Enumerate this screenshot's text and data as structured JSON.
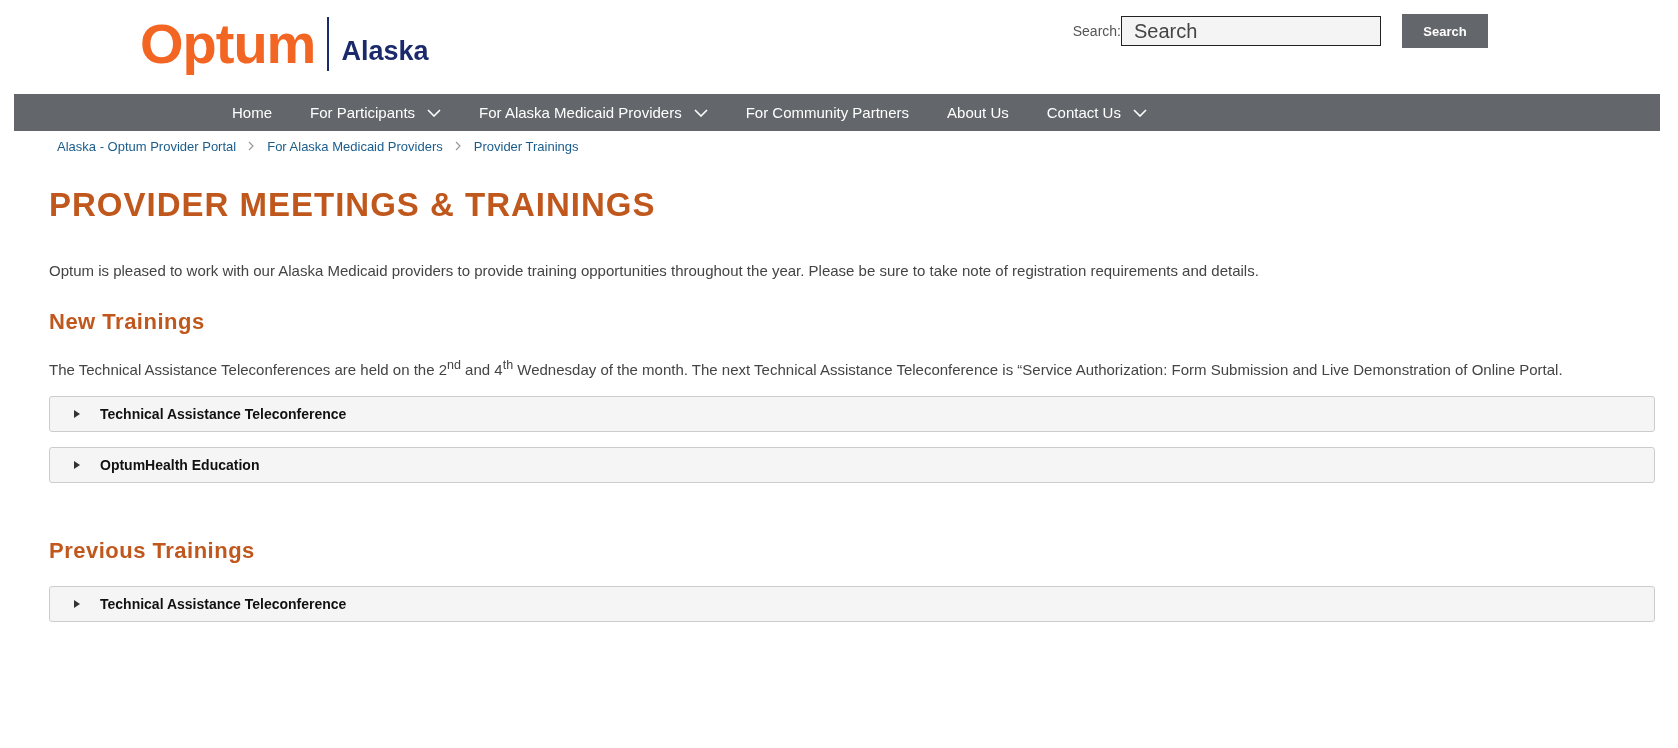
{
  "logo": {
    "brand": "Optum",
    "region": "Alaska"
  },
  "search": {
    "label": "Search:",
    "placeholder": "Search",
    "button": "Search"
  },
  "nav": [
    {
      "label": "Home",
      "dropdown": false
    },
    {
      "label": "For Participants",
      "dropdown": true
    },
    {
      "label": "For Alaska Medicaid Providers",
      "dropdown": true
    },
    {
      "label": "For Community Partners",
      "dropdown": false
    },
    {
      "label": "About Us",
      "dropdown": false
    },
    {
      "label": "Contact Us",
      "dropdown": true
    }
  ],
  "breadcrumb": [
    "Alaska - Optum Provider Portal",
    "For Alaska Medicaid Providers",
    "Provider Trainings"
  ],
  "title": "PROVIDER MEETINGS & TRAININGS",
  "intro": "Optum is pleased to work with our Alaska Medicaid providers to provide training opportunities throughout the year.  Please be sure to take note of registration requirements and details.",
  "sections": [
    {
      "heading": "New Trainings",
      "text": "The Technical Assistance Teleconferences are held on the 2$^{nd}$ and 4$^{th}$ Wednesday of the month. The next Technical Assistance Teleconference is “Service Authorization: Form Submission and Live Demonstration of Online Portal.",
      "accordions": [
        {
          "label": "Technical Assistance Teleconference",
          "expanded": false
        },
        {
          "label": "OptumHealth Education",
          "expanded": false
        }
      ]
    },
    {
      "heading": "Previous Trainings",
      "accordions": [
        {
          "label": "Technical Assistance Teleconference",
          "expanded": false
        }
      ]
    }
  ]
}
